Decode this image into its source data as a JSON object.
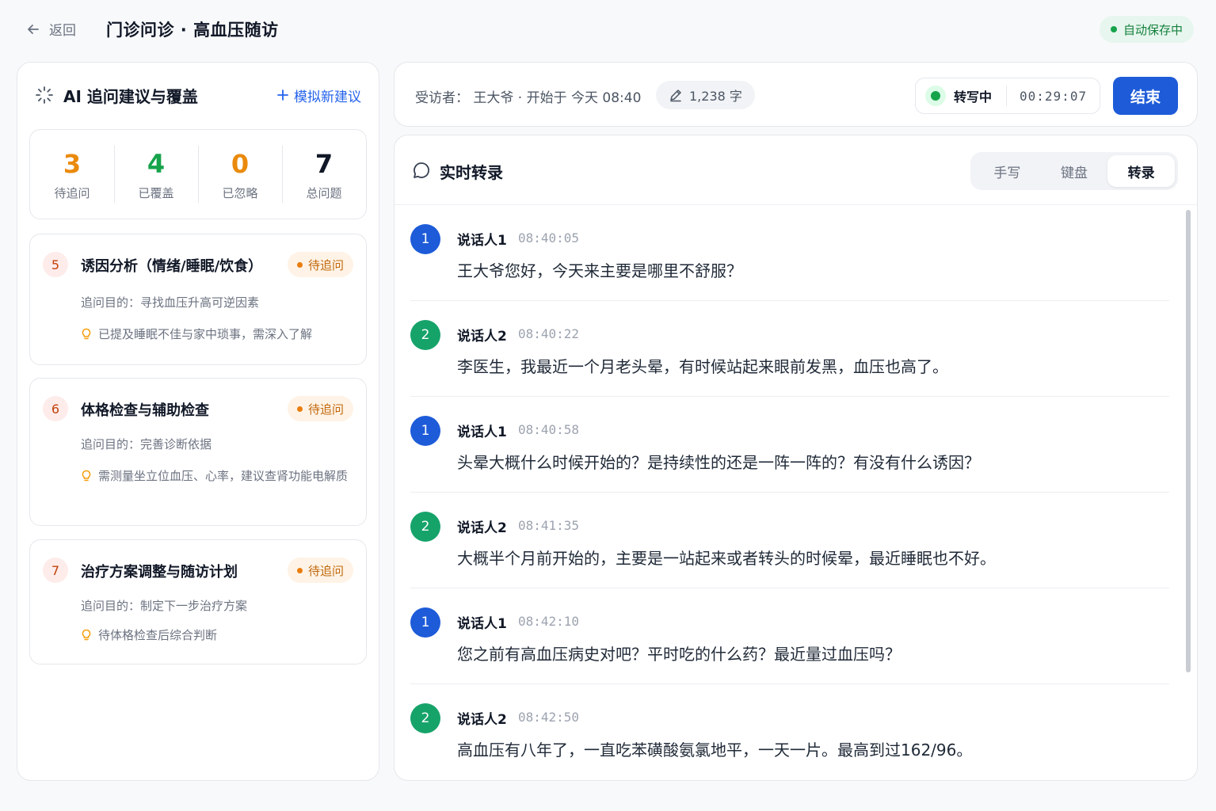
{
  "header": {
    "back_label": "返回",
    "title": "门诊问诊 · 高血压随访",
    "autosave": "自动保存中"
  },
  "suggestions": {
    "title": "AI 追问建议与覆盖",
    "add_label": "模拟新建议",
    "stats": [
      {
        "value": "3",
        "label": "待追问",
        "color": "#ea8a0c"
      },
      {
        "value": "4",
        "label": "已覆盖",
        "color": "#16a34a"
      },
      {
        "value": "0",
        "label": "已忽略",
        "color": "#ea8a0c"
      },
      {
        "value": "7",
        "label": "总问题",
        "color": "#111827"
      }
    ],
    "cards": [
      {
        "num": "5",
        "title": "诱因分析（情绪/睡眠/饮食）",
        "badge": "待追问",
        "purpose": "追问目的：寻找血压升高可逆因素",
        "note": "已提及睡眠不佳与家中琐事，需深入了解"
      },
      {
        "num": "6",
        "title": "体格检查与辅助检查",
        "badge": "待追问",
        "purpose": "追问目的：完善诊断依据",
        "note": "需测量坐立位血压、心率，建议查肾功能电解质"
      },
      {
        "num": "7",
        "title": "治疗方案调整与随访计划",
        "badge": "待追问",
        "purpose": "追问目的：制定下一步治疗方案",
        "note": "待体格检查后综合判断"
      }
    ]
  },
  "session": {
    "interviewee": "受访者：  王大爷 · 开始于 今天 08:40",
    "word_count": "1,238 字",
    "recording_label": "转写中",
    "timer": "00:29:07",
    "end_label": "结束"
  },
  "transcript": {
    "title": "实时转录",
    "modes": [
      "手写",
      "键盘",
      "转录"
    ],
    "active_mode": "转录",
    "speaker_colors": {
      "1": "#1d5bd8",
      "2": "#16a36a"
    },
    "messages": [
      {
        "avatar": "1",
        "speaker": "说话人1",
        "time": "08:40:05",
        "text": "王大爷您好，今天来主要是哪里不舒服？"
      },
      {
        "avatar": "2",
        "speaker": "说话人2",
        "time": "08:40:22",
        "text": "李医生，我最近一个月老头晕，有时候站起来眼前发黑，血压也高了。"
      },
      {
        "avatar": "1",
        "speaker": "说话人1",
        "time": "08:40:58",
        "text": "头晕大概什么时候开始的？是持续性的还是一阵一阵的？有没有什么诱因？"
      },
      {
        "avatar": "2",
        "speaker": "说话人2",
        "time": "08:41:35",
        "text": "大概半个月前开始的，主要是一站起来或者转头的时候晕，最近睡眠也不好。"
      },
      {
        "avatar": "1",
        "speaker": "说话人1",
        "time": "08:42:10",
        "text": "您之前有高血压病史对吧？平时吃的什么药？最近量过血压吗？"
      },
      {
        "avatar": "2",
        "speaker": "说话人2",
        "time": "08:42:50",
        "text": "高血压有八年了，一直吃苯磺酸氨氯地平，一天一片。最高到过162/96。"
      }
    ]
  }
}
